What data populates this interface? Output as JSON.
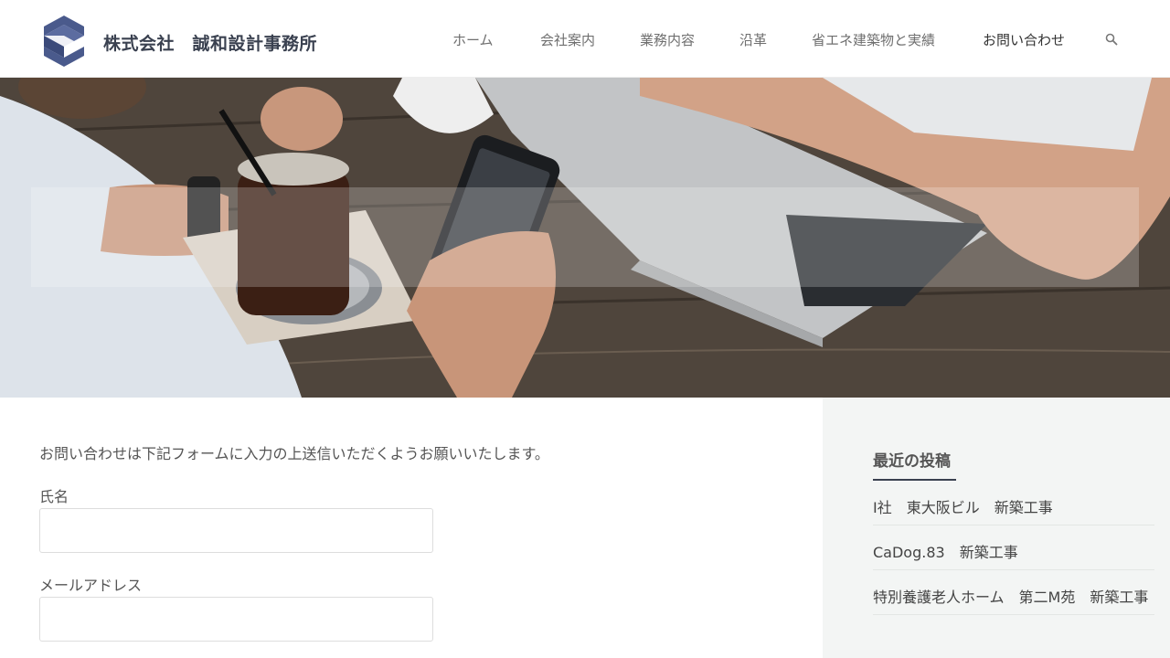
{
  "header": {
    "site_title": "株式会社　誠和設計事務所",
    "nav": [
      {
        "label": "ホーム"
      },
      {
        "label": "会社案内"
      },
      {
        "label": "業務内容"
      },
      {
        "label": "沿革"
      },
      {
        "label": "省エネ建築物と実績"
      },
      {
        "label": "お問い合わせ"
      }
    ],
    "active_nav": "お問い合わせ",
    "search_icon": "search-icon"
  },
  "contact": {
    "intro": "お問い合わせは下記フォームに入力の上送信いただくようお願いいたします。",
    "name_label": "氏名",
    "name_value": "",
    "email_label": "メールアドレス",
    "email_value": ""
  },
  "sidebar": {
    "title": "最近の投稿",
    "posts": [
      {
        "label": "I社　東大阪ビル　新築工事"
      },
      {
        "label": "CaDog.83　新築工事"
      },
      {
        "label": "特別養護老人ホーム　第二M苑　新築工事"
      }
    ]
  },
  "colors": {
    "brand": "#3a4150",
    "logo": "#4a5a8c",
    "sidebar_bg": "#f3f5f4"
  }
}
